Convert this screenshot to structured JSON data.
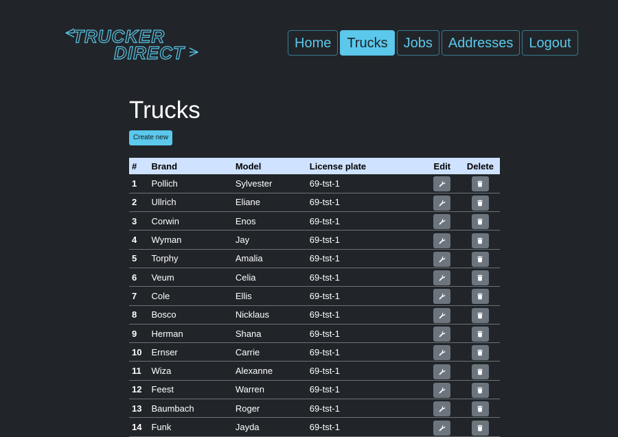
{
  "logo": {
    "line1": "TRUCKER",
    "line2": "DIRECT"
  },
  "nav": [
    {
      "label": "Home",
      "active": false
    },
    {
      "label": "Trucks",
      "active": true
    },
    {
      "label": "Jobs",
      "active": false
    },
    {
      "label": "Addresses",
      "active": false
    },
    {
      "label": "Logout",
      "active": false
    }
  ],
  "page": {
    "title": "Trucks",
    "create_label": "Create new"
  },
  "colors": {
    "background": "#212529",
    "accent": "#5bc8ec",
    "header_row": "#cfe2ff",
    "icon_button": "#6c757d"
  },
  "table": {
    "headers": {
      "num": "#",
      "brand": "Brand",
      "model": "Model",
      "plate": "License plate",
      "edit": "Edit",
      "delete": "Delete"
    },
    "rows": [
      {
        "num": "1",
        "brand": "Pollich",
        "model": "Sylvester",
        "plate": "69-tst-1"
      },
      {
        "num": "2",
        "brand": "Ullrich",
        "model": "Eliane",
        "plate": "69-tst-1"
      },
      {
        "num": "3",
        "brand": "Corwin",
        "model": "Enos",
        "plate": "69-tst-1"
      },
      {
        "num": "4",
        "brand": "Wyman",
        "model": "Jay",
        "plate": "69-tst-1"
      },
      {
        "num": "5",
        "brand": "Torphy",
        "model": "Amalia",
        "plate": "69-tst-1"
      },
      {
        "num": "6",
        "brand": "Veum",
        "model": "Celia",
        "plate": "69-tst-1"
      },
      {
        "num": "7",
        "brand": "Cole",
        "model": "Ellis",
        "plate": "69-tst-1"
      },
      {
        "num": "8",
        "brand": "Bosco",
        "model": "Nicklaus",
        "plate": "69-tst-1"
      },
      {
        "num": "9",
        "brand": "Herman",
        "model": "Shana",
        "plate": "69-tst-1"
      },
      {
        "num": "10",
        "brand": "Ernser",
        "model": "Carrie",
        "plate": "69-tst-1"
      },
      {
        "num": "11",
        "brand": "Wiza",
        "model": "Alexanne",
        "plate": "69-tst-1"
      },
      {
        "num": "12",
        "brand": "Feest",
        "model": "Warren",
        "plate": "69-tst-1"
      },
      {
        "num": "13",
        "brand": "Baumbach",
        "model": "Roger",
        "plate": "69-tst-1"
      },
      {
        "num": "14",
        "brand": "Funk",
        "model": "Jayda",
        "plate": "69-tst-1"
      }
    ]
  }
}
